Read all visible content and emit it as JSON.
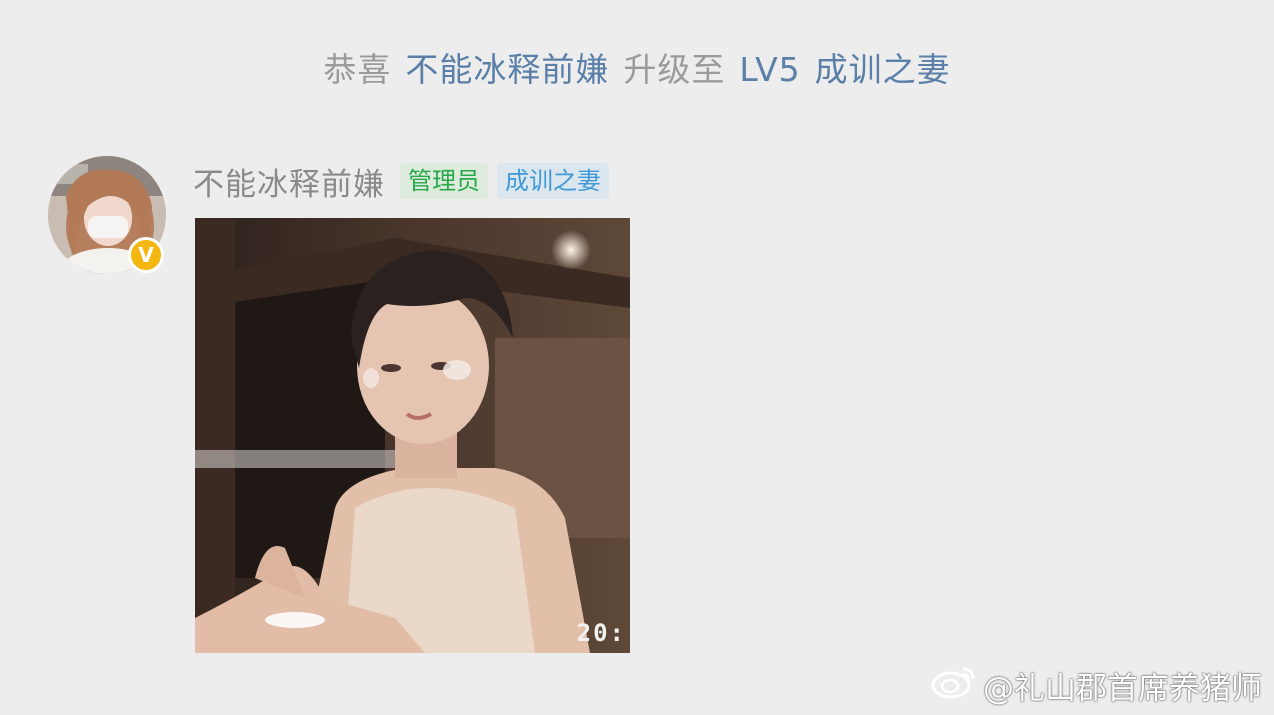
{
  "system_message": {
    "prefix": "恭喜",
    "user": "不能冰释前嫌",
    "middle": "升级至",
    "level": "LV5",
    "rank": "成训之妻"
  },
  "message": {
    "username": "不能冰释前嫌",
    "role_tag": "管理员",
    "rank_tag": "成训之妻",
    "image_timestamp": "20:",
    "verified_badge": "V"
  },
  "watermark": {
    "text": "@礼山郡首席养猪师",
    "icon": "weibo-icon"
  },
  "colors": {
    "background": "#ededed",
    "system_grey": "#9a9a9a",
    "system_blue": "#5a7fa8",
    "admin_tag_text": "#27a94b",
    "admin_tag_bg": "#dcebdc",
    "rank_tag_text": "#3f9ad7",
    "rank_tag_bg": "#dbe6ee",
    "verified_badge": "#f4b70f"
  }
}
